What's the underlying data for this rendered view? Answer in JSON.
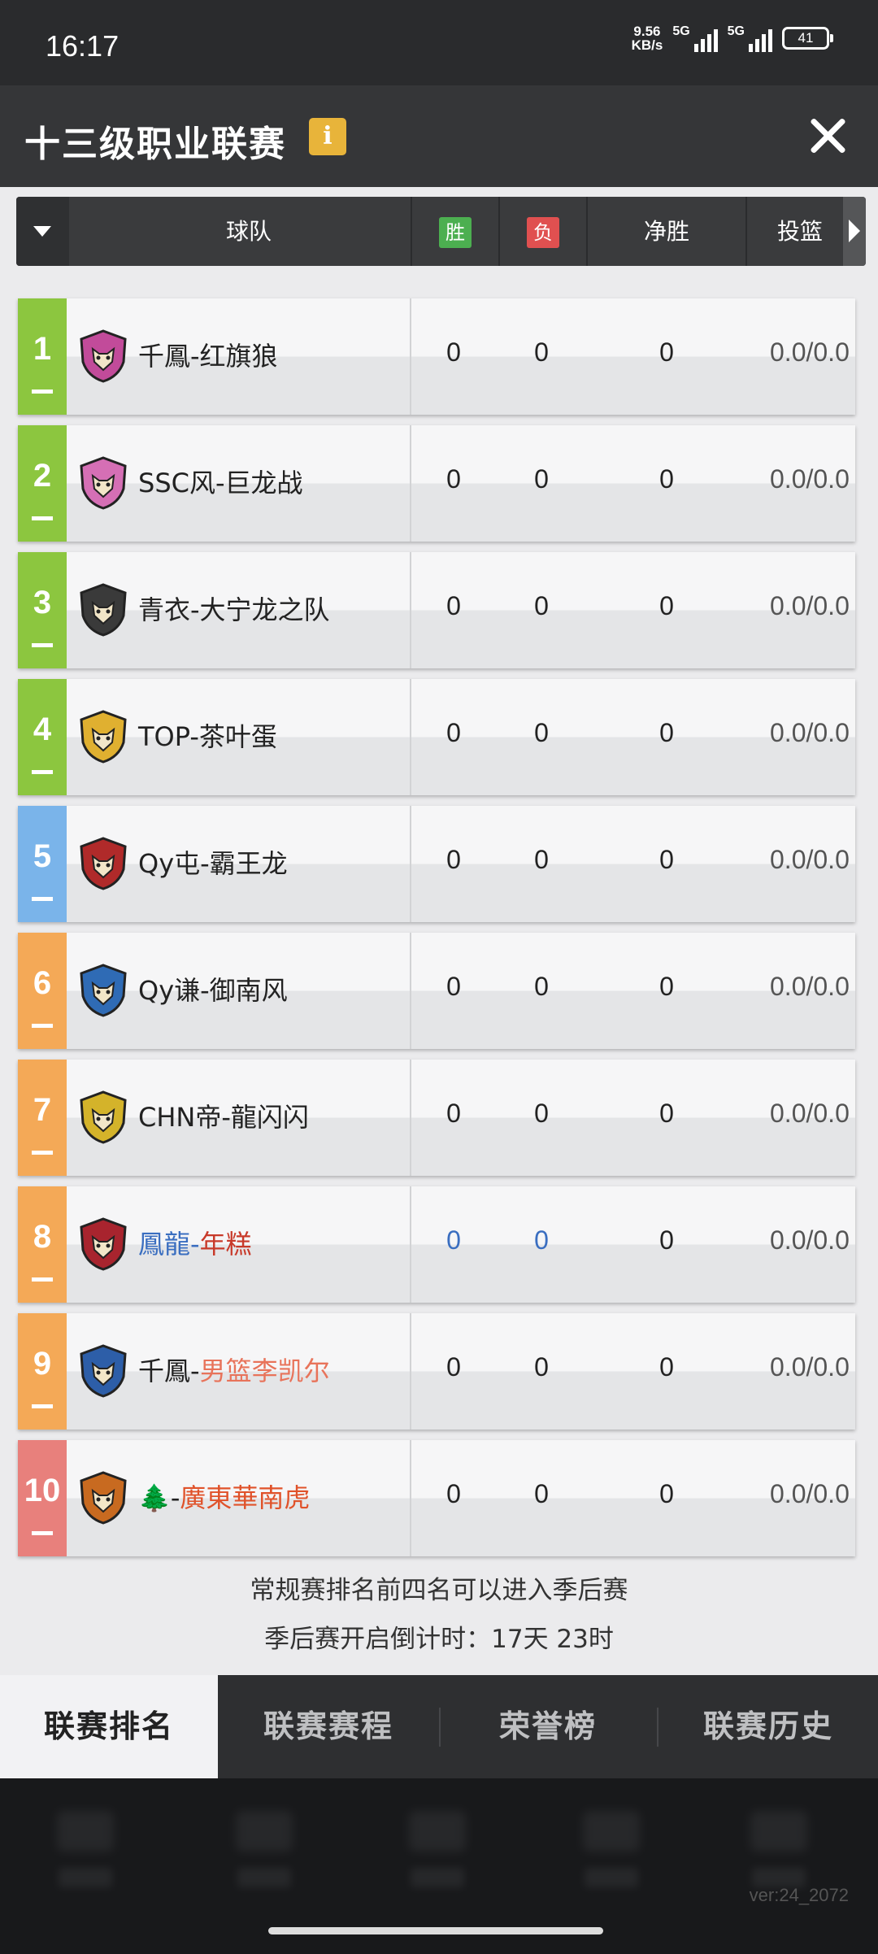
{
  "status_bar": {
    "time": "16:17",
    "net_speed_value": "9.56",
    "net_speed_unit": "KB/s",
    "signal1_label": "5G",
    "signal2_label": "5G",
    "battery": "41"
  },
  "title_bar": {
    "title": "十三级职业联赛",
    "info_icon": "i",
    "close_icon": "close-icon"
  },
  "table_header": {
    "team": "球队",
    "win": "胜",
    "loss": "负",
    "net_win": "净胜",
    "shooting": "投篮"
  },
  "rows": [
    {
      "rank": "1",
      "team": "千鳳-红旗狼",
      "team_parts": [
        {
          "t": "千鳳-红旗狼",
          "c": "#222222"
        }
      ],
      "win": "0",
      "loss": "0",
      "net": "0",
      "shoot": "0.0/0.0",
      "rank_color": "#8cc63f",
      "logo_color": "#c24b9a"
    },
    {
      "rank": "2",
      "team": "SSC风-巨龙战",
      "team_parts": [
        {
          "t": "SSC风-巨龙战",
          "c": "#222222"
        }
      ],
      "win": "0",
      "loss": "0",
      "net": "0",
      "shoot": "0.0/0.0",
      "rank_color": "#8cc63f",
      "logo_color": "#d56fb5"
    },
    {
      "rank": "3",
      "team": "青衣-大宁龙之队",
      "team_parts": [
        {
          "t": "青衣-大宁龙之队",
          "c": "#222222"
        }
      ],
      "win": "0",
      "loss": "0",
      "net": "0",
      "shoot": "0.0/0.0",
      "rank_color": "#8cc63f",
      "logo_color": "#3a3a3a"
    },
    {
      "rank": "4",
      "team": "TOP-茶叶蛋",
      "team_parts": [
        {
          "t": "TOP-茶叶蛋",
          "c": "#222222"
        }
      ],
      "win": "0",
      "loss": "0",
      "net": "0",
      "shoot": "0.0/0.0",
      "rank_color": "#8cc63f",
      "logo_color": "#e0b030"
    },
    {
      "rank": "5",
      "team": "Qy屯-霸王龙",
      "team_parts": [
        {
          "t": "Qy屯-霸王龙",
          "c": "#222222"
        }
      ],
      "win": "0",
      "loss": "0",
      "net": "0",
      "shoot": "0.0/0.0",
      "rank_color": "#7ab4ea",
      "logo_color": "#b02a2a"
    },
    {
      "rank": "6",
      "team": "Qy谦-御南风",
      "team_parts": [
        {
          "t": "Qy谦-御南风",
          "c": "#222222"
        }
      ],
      "win": "0",
      "loss": "0",
      "net": "0",
      "shoot": "0.0/0.0",
      "rank_color": "#f4a957",
      "logo_color": "#2f6bb5"
    },
    {
      "rank": "7",
      "team": "CHN帝-龍闪闪",
      "team_parts": [
        {
          "t": "CHN帝-龍闪闪",
          "c": "#222222"
        }
      ],
      "win": "0",
      "loss": "0",
      "net": "0",
      "shoot": "0.0/0.0",
      "rank_color": "#f4a957",
      "logo_color": "#d4b32a"
    },
    {
      "rank": "8",
      "team": "鳳龍-年糕",
      "team_parts": [
        {
          "t": "鳳龍-",
          "c": "#3a6ec0"
        },
        {
          "t": "年糕",
          "c": "#c83a2a"
        }
      ],
      "win": "0",
      "loss": "0",
      "net": "0",
      "shoot": "0.0/0.0",
      "rank_color": "#f4a957",
      "logo_color": "#a8242e",
      "stat_color": "#3a6ec0"
    },
    {
      "rank": "9",
      "team": "千鳳-男篮李凯尔",
      "team_parts": [
        {
          "t": "千鳳-",
          "c": "#222222"
        },
        {
          "t": "男篮李凯尔",
          "c": "#e8735a"
        }
      ],
      "win": "0",
      "loss": "0",
      "net": "0",
      "shoot": "0.0/0.0",
      "rank_color": "#f4a957",
      "logo_color": "#2d5ea8"
    },
    {
      "rank": "10",
      "team": "🌲-廣東華南虎",
      "team_parts": [
        {
          "t": "🌲",
          "c": "#2e8b3a"
        },
        {
          "t": "-",
          "c": "#222222"
        },
        {
          "t": "廣東華南虎",
          "c": "#e0522a"
        }
      ],
      "win": "0",
      "loss": "0",
      "net": "0",
      "shoot": "0.0/0.0",
      "rank_color": "#e8807c",
      "logo_color": "#c86a20"
    }
  ],
  "notes": {
    "playoff": "常规赛排名前四名可以进入季后赛",
    "countdown": "季后赛开启倒计时：17天 23时"
  },
  "tabs": [
    {
      "label": "联赛排名",
      "active": true
    },
    {
      "label": "联赛赛程",
      "active": false
    },
    {
      "label": "荣誉榜",
      "active": false
    },
    {
      "label": "联赛历史",
      "active": false
    }
  ],
  "version": "ver:24_2072"
}
